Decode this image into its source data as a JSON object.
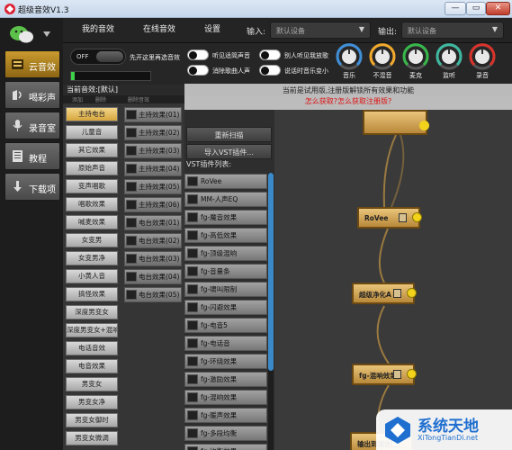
{
  "window": {
    "title": "超级音效V1.3",
    "min": "—",
    "max": "▭",
    "close": "✕"
  },
  "leftnav": [
    {
      "label": "云音效",
      "icon": "cloud-icon",
      "active": true
    },
    {
      "label": "喝彩声",
      "icon": "cheer-icon",
      "active": false
    },
    {
      "label": "录音室",
      "icon": "microphone-icon",
      "active": false
    },
    {
      "label": "教程",
      "icon": "book-icon",
      "active": false
    },
    {
      "label": "下载项",
      "icon": "download-icon",
      "active": false
    }
  ],
  "topnav": {
    "tabs": [
      "我的音效",
      "在线音效",
      "设置"
    ],
    "input_label": "输入:",
    "input_value": "默认设备",
    "output_label": "输出:",
    "output_value": "默认设备"
  },
  "controls": {
    "main_toggle": "OFF",
    "main_toggle_label": "先开这里再选音效",
    "options": [
      "听见适简声音",
      "别人听见我放歌",
      "消除歌曲人声",
      "说话时音乐变小"
    ],
    "knobs": [
      {
        "label": "音乐",
        "color": "#3f8fd8"
      },
      {
        "label": "不混音",
        "color": "#f2a92b"
      },
      {
        "label": "麦克",
        "color": "#37b84a"
      },
      {
        "label": "监听",
        "color": "#3fb8a0"
      },
      {
        "label": "录音",
        "color": "#d8332b"
      }
    ]
  },
  "notice": {
    "line1": "当前是试用版,注册版解锁所有效果和功能",
    "line2": "怎么获取?怎么获取注册版?"
  },
  "panel": {
    "title": "当前音效:[默认]",
    "sub": [
      "添加",
      "删除",
      "删除音效"
    ]
  },
  "presets": [
    "主持电台",
    "儿童音",
    "其它效果",
    "原始声音",
    "变声唱歌",
    "唱歌效果",
    "喊麦效果",
    "女变男",
    "女变男净",
    "小黄人音",
    "搞怪效果",
    "深度男变女",
    "深度男变女+混响",
    "电话音效",
    "电音效果",
    "男变女",
    "男变女净",
    "男变女御时",
    "男变女微调"
  ],
  "effects": [
    "主持效果(01)",
    "主持效果(02)",
    "主持效果(03)",
    "主持效果(04)",
    "主持效果(05)",
    "主持效果(06)",
    "电台效果(01)",
    "电台效果(02)",
    "电台效果(03)",
    "电台效果(04)",
    "电台效果(05)"
  ],
  "mid": {
    "rescan": "重新扫描",
    "import_vst": "导入VST插件...",
    "vst_header": "VST插件列表:"
  },
  "vst": [
    "RoVee",
    "MM-人声EQ",
    "fg-魔音效果",
    "fg-高低效果",
    "fg-顶级混响",
    "fg-音量条",
    "fg-啸叫限制",
    "fg-闪避效果",
    "fg-电音5",
    "fg-电话音",
    "fg-环绕效果",
    "fg-激励效果",
    "fg-混响效果",
    "fg-暖声效果",
    "fg-多段均衡",
    "fg-均衡效果"
  ],
  "nodes": [
    "RoVee",
    "超级净化A",
    "fg-混响效果",
    "输出到播放"
  ],
  "watermark": {
    "title": "系统天地",
    "sub": "XiTongTianDi.net"
  }
}
